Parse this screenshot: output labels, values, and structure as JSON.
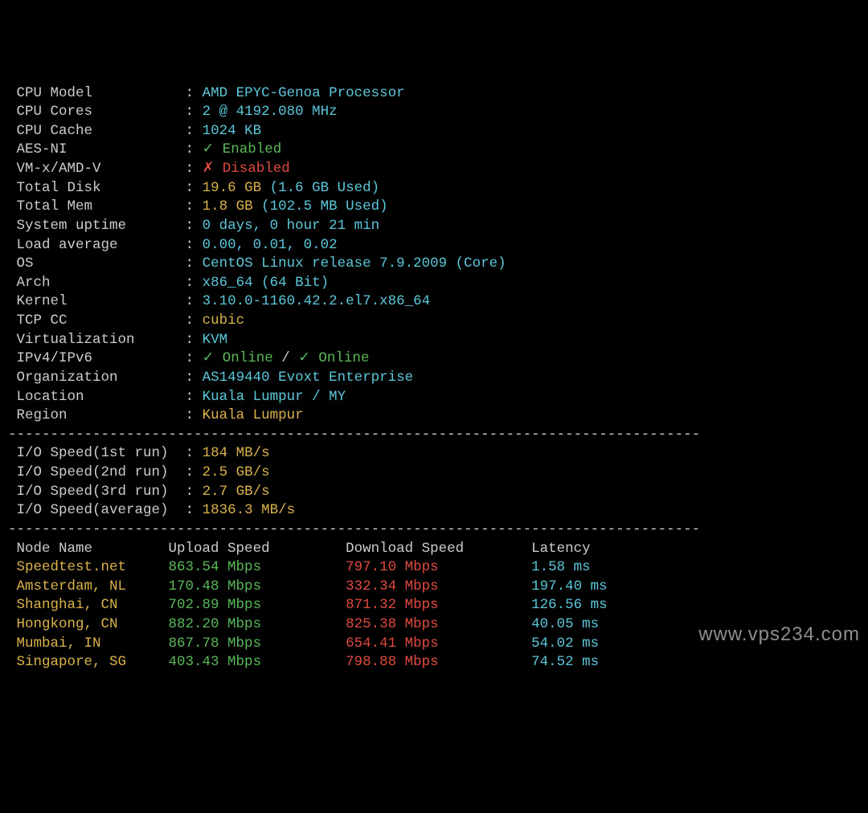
{
  "info": [
    {
      "label": "CPU Model",
      "parts": [
        {
          "t": "AMD EPYC-Genoa Processor",
          "c": "cyan"
        }
      ]
    },
    {
      "label": "CPU Cores",
      "parts": [
        {
          "t": "2 @ 4192.080 MHz",
          "c": "cyan"
        }
      ]
    },
    {
      "label": "CPU Cache",
      "parts": [
        {
          "t": "1024 KB",
          "c": "cyan"
        }
      ]
    },
    {
      "label": "AES-NI",
      "parts": [
        {
          "t": "✓ Enabled",
          "c": "green"
        }
      ]
    },
    {
      "label": "VM-x/AMD-V",
      "parts": [
        {
          "t": "✗ Disabled",
          "c": "red"
        }
      ]
    },
    {
      "label": "Total Disk",
      "parts": [
        {
          "t": "19.6 GB",
          "c": "yellow"
        },
        {
          "t": " (1.6 GB Used)",
          "c": "cyan"
        }
      ]
    },
    {
      "label": "Total Mem",
      "parts": [
        {
          "t": "1.8 GB",
          "c": "yellow"
        },
        {
          "t": " (102.5 MB Used)",
          "c": "cyan"
        }
      ]
    },
    {
      "label": "System uptime",
      "parts": [
        {
          "t": "0 days, 0 hour 21 min",
          "c": "cyan"
        }
      ]
    },
    {
      "label": "Load average",
      "parts": [
        {
          "t": "0.00, 0.01, 0.02",
          "c": "cyan"
        }
      ]
    },
    {
      "label": "OS",
      "parts": [
        {
          "t": "CentOS Linux release 7.9.2009 (Core)",
          "c": "cyan"
        }
      ]
    },
    {
      "label": "Arch",
      "parts": [
        {
          "t": "x86_64 (64 Bit)",
          "c": "cyan"
        }
      ]
    },
    {
      "label": "Kernel",
      "parts": [
        {
          "t": "3.10.0-1160.42.2.el7.x86_64",
          "c": "cyan"
        }
      ]
    },
    {
      "label": "TCP CC",
      "parts": [
        {
          "t": "cubic",
          "c": "yellow"
        }
      ]
    },
    {
      "label": "Virtualization",
      "parts": [
        {
          "t": "KVM",
          "c": "cyan"
        }
      ]
    },
    {
      "label": "IPv4/IPv6",
      "parts": [
        {
          "t": "✓ Online",
          "c": "green"
        },
        {
          "t": " / ",
          "c": "grey"
        },
        {
          "t": "✓ Online",
          "c": "green"
        }
      ]
    },
    {
      "label": "Organization",
      "parts": [
        {
          "t": "AS149440 Evoxt Enterprise",
          "c": "cyan"
        }
      ]
    },
    {
      "label": "Location",
      "parts": [
        {
          "t": "Kuala Lumpur / MY",
          "c": "cyan"
        }
      ]
    },
    {
      "label": "Region",
      "parts": [
        {
          "t": "Kuala Lumpur",
          "c": "yellow"
        }
      ]
    }
  ],
  "ioLabelWidth": 19,
  "io": [
    {
      "label": "I/O Speed(1st run)",
      "value": "184 MB/s",
      "c": "yellow"
    },
    {
      "label": "I/O Speed(2nd run)",
      "value": "2.5 GB/s",
      "c": "yellow"
    },
    {
      "label": "I/O Speed(3rd run)",
      "value": "2.7 GB/s",
      "c": "yellow"
    },
    {
      "label": "I/O Speed(average)",
      "value": "1836.3 MB/s",
      "c": "yellow"
    }
  ],
  "speedHeader": {
    "node": "Node Name",
    "up": "Upload Speed",
    "down": "Download Speed",
    "lat": "Latency"
  },
  "speed": [
    {
      "node": "Speedtest.net",
      "up": "863.54 Mbps",
      "down": "797.10 Mbps",
      "lat": "1.58 ms"
    },
    {
      "node": "Amsterdam, NL",
      "up": "170.48 Mbps",
      "down": "332.34 Mbps",
      "lat": "197.40 ms"
    },
    {
      "node": "Shanghai, CN",
      "up": "702.89 Mbps",
      "down": "871.32 Mbps",
      "lat": "126.56 ms"
    },
    {
      "node": "Hongkong, CN",
      "up": "882.20 Mbps",
      "down": "825.38 Mbps",
      "lat": "40.05 ms"
    },
    {
      "node": "Mumbai, IN",
      "up": "867.78 Mbps",
      "down": "654.41 Mbps",
      "lat": "54.02 ms"
    },
    {
      "node": "Singapore, SG",
      "up": "403.43 Mbps",
      "down": "798.88 Mbps",
      "lat": "74.52 ms"
    }
  ],
  "cols": {
    "node": 18,
    "up": 21,
    "down": 22
  },
  "dash": "----------------------------------------------------------------------------------",
  "watermark": "www.vps234.com"
}
